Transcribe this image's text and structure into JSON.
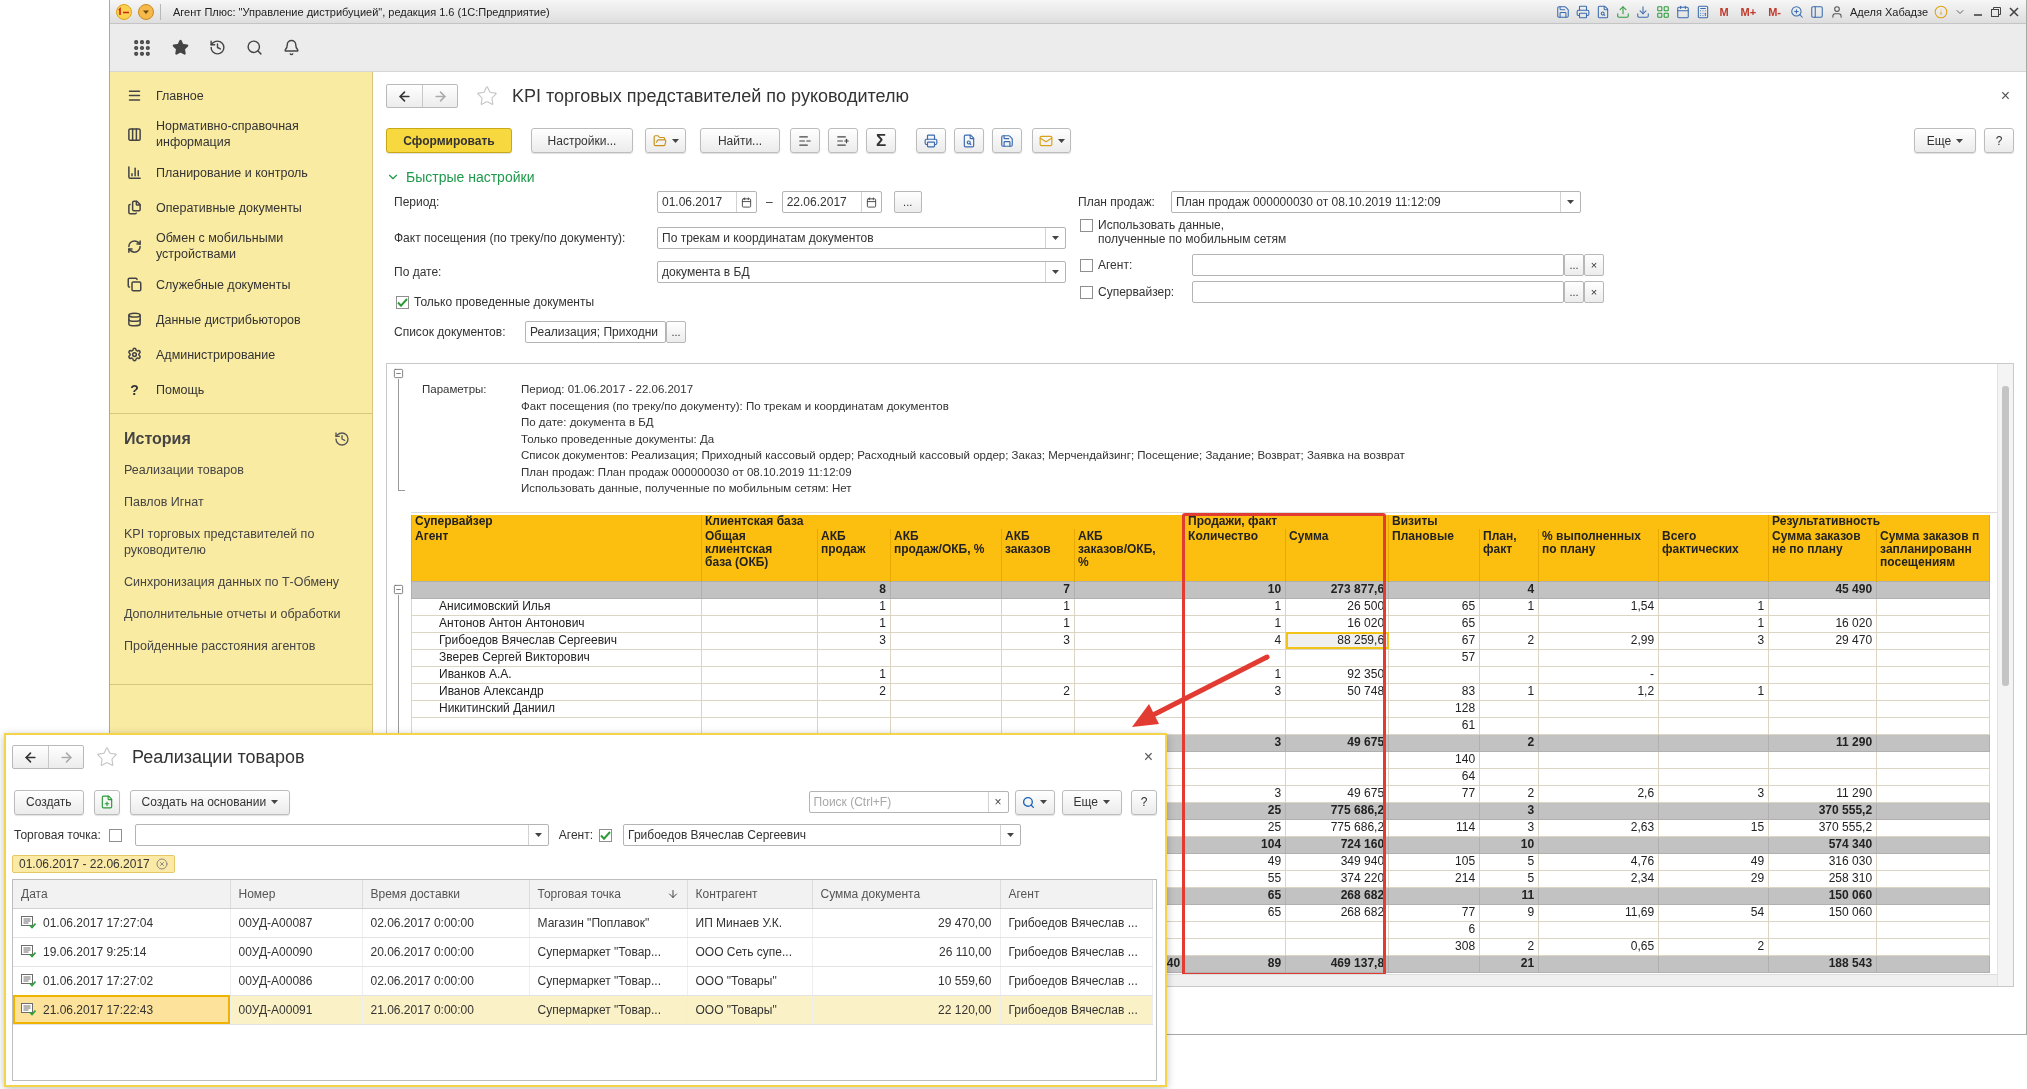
{
  "window": {
    "title": "Агент Плюс: \"Управление дистрибуцией\", редакция 1.6 (1С:Предприятие)",
    "memory": [
      "M",
      "M+",
      "M-"
    ],
    "user": "Аделя Хабадзе"
  },
  "sidebar": {
    "sections": [
      {
        "label": "Главное"
      },
      {
        "label": "Нормативно-справочная информация"
      },
      {
        "label": "Планирование и контроль"
      },
      {
        "label": "Оперативные документы"
      },
      {
        "label": "Обмен с мобильными устройствами"
      },
      {
        "label": "Служебные документы"
      },
      {
        "label": "Данные дистрибьюторов"
      },
      {
        "label": "Администрирование"
      },
      {
        "label": "Помощь",
        "glyph": "?"
      }
    ],
    "history": {
      "title": "История",
      "items": [
        "Реализации товаров",
        "Павлов Игнат",
        "KPI торговых представителей по руководителю",
        "Синхронизация данных по Т-Обмену",
        "Дополнительные отчеты и обработки",
        "Пройденные расстояния агентов"
      ]
    }
  },
  "report": {
    "title": "KPI торговых представителей по руководителю",
    "close": "×",
    "toolbar": {
      "generate": "Сформировать",
      "settings": "Настройки...",
      "find": "Найти...",
      "sum": "Σ",
      "more": "Еще",
      "help": "?"
    },
    "quick_settings": {
      "title": "Быстрые настройки",
      "expanded": true
    },
    "period": {
      "label": "Период:",
      "from": "01.06.2017",
      "dash": "–",
      "to": "22.06.2017",
      "button": "..."
    },
    "visit_fact": {
      "label": "Факт посещения (по треку/по документу):",
      "value": "По трекам и координатам документов"
    },
    "by_date": {
      "label": "По дате:",
      "value": "документа в БД"
    },
    "posted_only": {
      "label": "Только проведенные документы",
      "checked": true
    },
    "doc_list": {
      "label": "Список документов:",
      "value": "Реализация; Приходни",
      "button": "..."
    },
    "sales_plan": {
      "label": "План продаж:",
      "value": "План продаж 000000030 от 08.10.2019 11:12:09"
    },
    "mobile_data": {
      "label": "Использовать данные,\nполученные по мобильным сетям",
      "checked": false
    },
    "agent": {
      "label": "Агент:",
      "checked": false,
      "button": "...",
      "clear": "×"
    },
    "supervisor": {
      "label": "Супервайзер:",
      "checked": false,
      "button": "...",
      "clear": "×"
    },
    "parameters": {
      "label": "Параметры:",
      "lines": [
        "Период: 01.06.2017 - 22.06.2017",
        "Факт посещения (по треку/по документу): По трекам и координатам документов",
        "По дате: документа в БД",
        "Только проведенные документы: Да",
        "Список документов: Реализация; Приходный кассовый ордер; Расходный кассовый ордер; Заказ; Мерчендайзинг; Посещение; Задание; Возврат; Заявка на возврат",
        "План продаж: План продаж 000000030 от 08.10.2019 11:12:09",
        "Использовать данные, полученные по мобильным сетям: Нет"
      ]
    },
    "table": {
      "groups": [
        {
          "label": "Супервайзер",
          "columns": [
            "Агент"
          ]
        },
        {
          "label": "Клиентская база",
          "columns": [
            "Общая\nклиентская\nбаза (ОКБ)",
            "АКБ\nпродаж",
            "АКБ\nпродаж/ОКБ, %",
            "АКБ\nзаказов",
            "АКБ\nзаказов/ОКБ,\n%"
          ]
        },
        {
          "label": "Продажи, факт",
          "columns": [
            "Количество",
            "Сумма"
          ]
        },
        {
          "label": "Визиты",
          "columns": [
            "Плановые",
            "План,\nфакт",
            "% выполненных\nпо плану",
            "Всего\nфактических"
          ]
        },
        {
          "label": "Результативность",
          "columns": [
            "Сумма заказов\nне по плану",
            "Сумма заказов п\nзапланированн\nпосещениям"
          ]
        }
      ],
      "rows": [
        {
          "kind": "total",
          "cells": [
            null,
            null,
            "8",
            null,
            "7",
            null,
            "10",
            "273 877,6",
            null,
            "4",
            null,
            null,
            "45 490",
            null
          ]
        },
        {
          "kind": "agent",
          "cells": [
            "Анисимовский Илья",
            null,
            "1",
            null,
            "1",
            null,
            "1",
            "26 500",
            "65",
            "1",
            "1,54",
            "1",
            null,
            null
          ]
        },
        {
          "kind": "agent",
          "cells": [
            "Антонов Антон Антонович",
            null,
            "1",
            null,
            "1",
            null,
            "1",
            "16 020",
            "65",
            null,
            null,
            "1",
            "16 020",
            null
          ]
        },
        {
          "kind": "agent",
          "cells": [
            "Грибоедов Вячеслав Сергеевич",
            null,
            "3",
            null,
            "3",
            null,
            "4",
            {
              "text": "88 259,6",
              "selected": true
            },
            "67",
            "2",
            "2,99",
            "3",
            "29 470",
            null
          ]
        },
        {
          "kind": "agent",
          "cells": [
            "Зверев Сергей Викторович",
            null,
            null,
            null,
            null,
            null,
            null,
            null,
            "57",
            null,
            null,
            null,
            null,
            null
          ]
        },
        {
          "kind": "agent",
          "cells": [
            "Иванков А.А.",
            null,
            "1",
            null,
            null,
            null,
            "1",
            "92 350",
            null,
            null,
            "-",
            null,
            null,
            null
          ]
        },
        {
          "kind": "agent",
          "cells": [
            "Иванов Александр",
            null,
            "2",
            null,
            "2",
            null,
            "3",
            "50 748",
            "83",
            "1",
            "1,2",
            "1",
            null,
            null
          ]
        },
        {
          "kind": "agent",
          "cells": [
            "Никитинский Даниил",
            null,
            null,
            null,
            null,
            null,
            null,
            null,
            "128",
            null,
            null,
            null,
            null,
            null
          ]
        },
        {
          "kind": "agent",
          "cells": [
            null,
            null,
            null,
            null,
            null,
            null,
            null,
            null,
            "61",
            null,
            null,
            null,
            null,
            null
          ]
        },
        {
          "kind": "total",
          "cells": [
            null,
            null,
            null,
            null,
            null,
            null,
            "3",
            "49 675",
            null,
            "2",
            null,
            null,
            "11 290",
            null
          ]
        },
        {
          "kind": "agent",
          "cells": [
            null,
            null,
            null,
            null,
            null,
            null,
            null,
            null,
            "140",
            null,
            null,
            null,
            null,
            null
          ]
        },
        {
          "kind": "agent",
          "cells": [
            null,
            null,
            null,
            null,
            null,
            null,
            null,
            null,
            "64",
            null,
            null,
            null,
            null,
            null
          ]
        },
        {
          "kind": "agent",
          "cells": [
            null,
            null,
            null,
            null,
            null,
            null,
            "3",
            "49 675",
            "77",
            "2",
            "2,6",
            "3",
            "11 290",
            null
          ]
        },
        {
          "kind": "total",
          "cells": [
            null,
            null,
            null,
            null,
            null,
            null,
            "25",
            "775 686,2",
            null,
            "3",
            null,
            null,
            "370 555,2",
            null
          ]
        },
        {
          "kind": "agent",
          "cells": [
            null,
            null,
            null,
            null,
            null,
            null,
            "25",
            "775 686,2",
            "114",
            "3",
            "2,63",
            "15",
            "370 555,2",
            null
          ]
        },
        {
          "kind": "total",
          "cells": [
            null,
            null,
            null,
            null,
            null,
            null,
            "104",
            "724 160",
            null,
            "10",
            null,
            null,
            "574 340",
            null
          ]
        },
        {
          "kind": "agent",
          "cells": [
            null,
            null,
            null,
            null,
            null,
            null,
            "49",
            "349 940",
            "105",
            "5",
            "4,76",
            "49",
            "316 030",
            null
          ]
        },
        {
          "kind": "agent",
          "cells": [
            null,
            null,
            null,
            null,
            null,
            null,
            "55",
            "374 220",
            "214",
            "5",
            "2,34",
            "29",
            "258 310",
            null
          ]
        },
        {
          "kind": "total",
          "cells": [
            null,
            null,
            null,
            null,
            null,
            null,
            "65",
            "268 682",
            null,
            "11",
            null,
            null,
            "150 060",
            null
          ]
        },
        {
          "kind": "agent",
          "cells": [
            null,
            null,
            null,
            null,
            null,
            null,
            "65",
            "268 682",
            "77",
            "9",
            "11,69",
            "54",
            "150 060",
            null
          ]
        },
        {
          "kind": "agent",
          "cells": [
            null,
            null,
            null,
            null,
            null,
            null,
            null,
            null,
            "6",
            null,
            null,
            null,
            null,
            null
          ]
        },
        {
          "kind": "agent",
          "cells": [
            null,
            null,
            null,
            null,
            null,
            null,
            null,
            null,
            "308",
            "2",
            "0,65",
            "2",
            null,
            null
          ]
        },
        {
          "kind": "total",
          "cells": [
            null,
            null,
            null,
            null,
            null,
            "40",
            "89",
            "469 137,8",
            null,
            "21",
            null,
            null,
            "188 543",
            null
          ]
        }
      ]
    }
  },
  "list_window": {
    "title": "Реализации товаров",
    "close": "×",
    "create": "Создать",
    "create_based": "Создать на основании",
    "search_placeholder": "Поиск (Ctrl+F)",
    "search_clear": "×",
    "more": "Еще",
    "help": "?",
    "outlet_filter": {
      "label": "Торговая точка:",
      "checked": false
    },
    "agent_filter": {
      "label": "Агент:",
      "checked": true,
      "value": "Грибоедов Вячеслав Сергеевич"
    },
    "period_chip": "01.06.2017 - 22.06.2017",
    "columns": [
      {
        "label": "Дата",
        "sorted": false
      },
      {
        "label": "Номер",
        "sorted": false
      },
      {
        "label": "Время доставки",
        "sorted": false
      },
      {
        "label": "Торговая точка",
        "sorted": true
      },
      {
        "label": "Контрагент",
        "sorted": false
      },
      {
        "label": "Сумма документа",
        "sorted": false
      },
      {
        "label": "Агент",
        "sorted": false
      }
    ],
    "rows": [
      {
        "selected": false,
        "cells": [
          "01.06.2017 17:27:04",
          "00УД-А00087",
          "02.06.2017 0:00:00",
          "Магазин \"Поплавок\"",
          "ИП Минаев У.К.",
          "29 470,00",
          "Грибоедов Вячеслав ..."
        ]
      },
      {
        "selected": false,
        "cells": [
          "19.06.2017 9:25:14",
          "00УД-А00090",
          "20.06.2017 0:00:00",
          "Супермаркет \"Товар...",
          "ООО Сеть супе...",
          "26 110,00",
          "Грибоедов Вячеслав ..."
        ]
      },
      {
        "selected": false,
        "cells": [
          "01.06.2017 17:27:02",
          "00УД-А00086",
          "02.06.2017 0:00:00",
          "Супермаркет \"Товар...",
          "ООО \"Товары\"",
          "10 559,60",
          "Грибоедов Вячеслав ..."
        ]
      },
      {
        "selected": true,
        "cells": [
          "21.06.2017 17:22:43",
          "00УД-А00091",
          "21.06.2017 0:00:00",
          "Супермаркет \"Товар...",
          "ООО \"Товары\"",
          "22 120,00",
          "Грибоедов Вячеслав ..."
        ]
      }
    ]
  }
}
